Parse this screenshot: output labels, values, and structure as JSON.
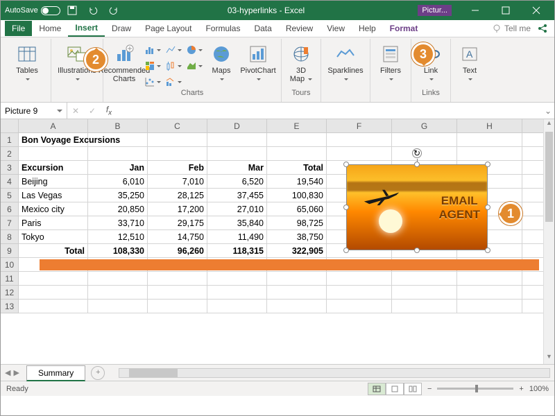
{
  "titlebar": {
    "autosave": "AutoSave",
    "title": "03-hyperlinks - Excel",
    "context": "Pictur..."
  },
  "tabs": {
    "file": "File",
    "home": "Home",
    "insert": "Insert",
    "draw": "Draw",
    "pagelayout": "Page Layout",
    "formulas": "Formulas",
    "data": "Data",
    "review": "Review",
    "view": "View",
    "help": "Help",
    "format": "Format",
    "tellme": "Tell me"
  },
  "ribbon": {
    "tables": "Tables",
    "illustrations": "Illustrations",
    "recommended": "Recommended",
    "charts": "Charts",
    "maps": "Maps",
    "pivotchart": "PivotChart",
    "chartsgrp": "Charts",
    "threedmap": "3D",
    "map": "Map",
    "tours": "Tours",
    "sparklines": "Sparklines",
    "filters": "Filters",
    "link": "Link",
    "links": "Links",
    "text": "Text"
  },
  "namebox": "Picture 9",
  "columns": [
    "A",
    "B",
    "C",
    "D",
    "E",
    "F",
    "G",
    "H"
  ],
  "cells": {
    "title": "Bon Voyage Excursions",
    "h_exc": "Excursion",
    "h_jan": "Jan",
    "h_feb": "Feb",
    "h_mar": "Mar",
    "h_tot": "Total",
    "r1": [
      "Beijing",
      "6,010",
      "7,010",
      "6,520",
      "19,540"
    ],
    "r2": [
      "Las Vegas",
      "35,250",
      "28,125",
      "37,455",
      "100,830"
    ],
    "r3": [
      "Mexico city",
      "20,850",
      "17,200",
      "27,010",
      "65,060"
    ],
    "r4": [
      "Paris",
      "33,710",
      "29,175",
      "35,840",
      "98,725"
    ],
    "r5": [
      "Tokyo",
      "12,510",
      "14,750",
      "11,490",
      "38,750"
    ],
    "totlabel": "Total",
    "tot": [
      "108,330",
      "96,260",
      "118,315",
      "322,905"
    ]
  },
  "image_text1": "EMAIL",
  "image_text2": "AGENT",
  "sheet": "Summary",
  "status": "Ready",
  "zoom": "100%",
  "callouts": {
    "c1": "1",
    "c2": "2",
    "c3": "3"
  }
}
